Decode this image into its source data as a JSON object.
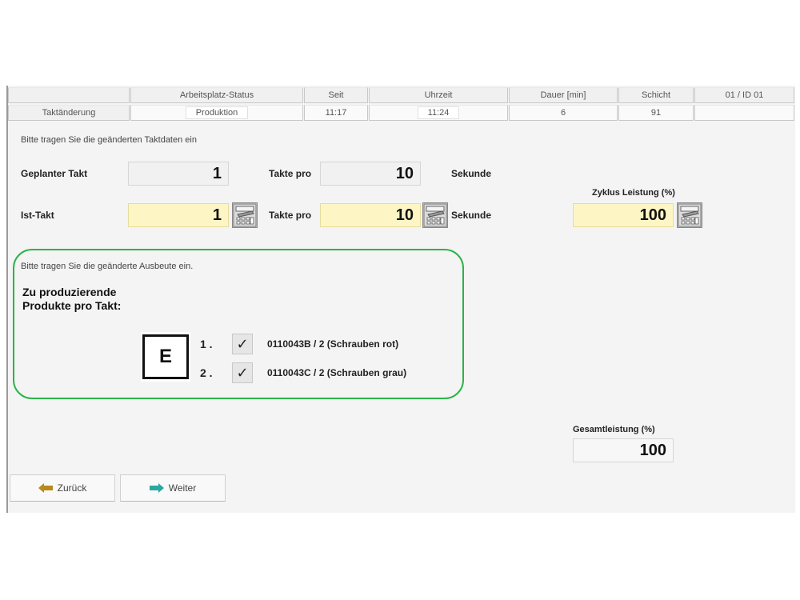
{
  "header": {
    "columns": [
      "",
      "Arbeitsplatz-Status",
      "Seit",
      "Uhrzeit",
      "Dauer [min]",
      "Schicht",
      "01 / ID 01"
    ],
    "values": [
      "Taktänderung",
      "Produktion",
      "11:17",
      "11:24",
      "6",
      "91",
      ""
    ]
  },
  "takt": {
    "intro": "Bitte tragen Sie die geänderten Taktdaten ein",
    "planned_label": "Geplanter Takt",
    "planned_value": "1",
    "planned_per_label": "Takte pro",
    "planned_per_value": "10",
    "planned_unit": "Sekunde",
    "actual_label": "Ist-Takt",
    "actual_value": "1",
    "actual_per_label": "Takte pro",
    "actual_per_value": "10",
    "actual_unit": "Sekunde",
    "cycle_label": "Zyklus Leistung (%)",
    "cycle_value": "100",
    "calculator_icon": "calculator-icon"
  },
  "yield": {
    "intro": "Bitte tragen Sie die geänderte Ausbeute ein.",
    "products_title": "Zu produzierende Produkte pro Takt:",
    "badge": "E",
    "products": [
      {
        "num": "1 .",
        "checked": "✓",
        "text": "0110043B / 2  (Schrauben rot)"
      },
      {
        "num": "2 .",
        "checked": "✓",
        "text": "0110043C / 2  (Schrauben grau)"
      }
    ]
  },
  "total": {
    "label": "Gesamtleistung (%)",
    "value": "100"
  },
  "nav": {
    "back_label": "Zurück",
    "next_label": "Weiter",
    "back_icon": "arrow-left-icon",
    "next_icon": "arrow-right-icon",
    "accent": "#2aa8a0"
  },
  "colors": {
    "highlight_field": "#fdf5c4",
    "group_border": "#2db34a"
  }
}
